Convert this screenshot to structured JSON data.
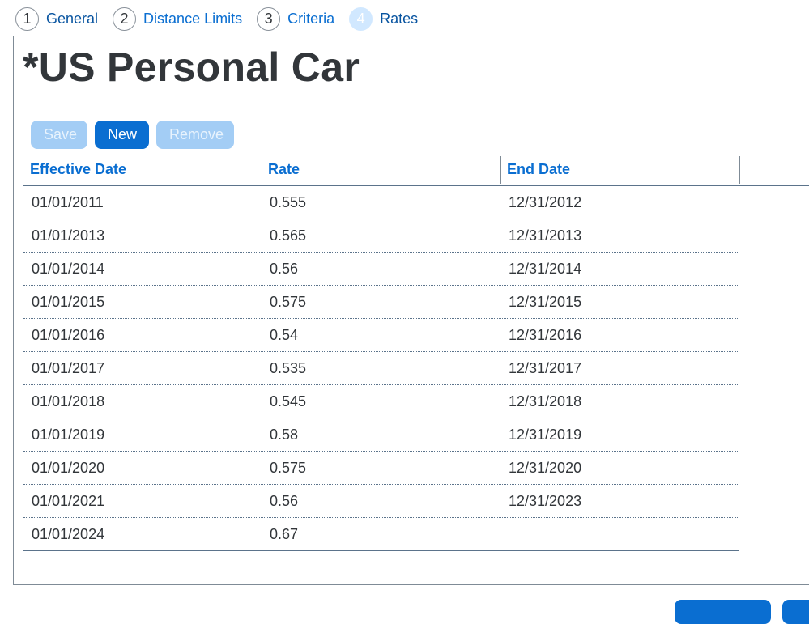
{
  "wizard": {
    "steps": [
      {
        "number": "1",
        "label": "General"
      },
      {
        "number": "2",
        "label": "Distance Limits"
      },
      {
        "number": "3",
        "label": "Criteria"
      },
      {
        "number": "4",
        "label": "Rates"
      }
    ],
    "current_step": 4
  },
  "page": {
    "title": "*US Personal Car"
  },
  "toolbar": {
    "save_label": "Save",
    "new_label": "New",
    "remove_label": "Remove"
  },
  "table": {
    "columns": [
      "Effective Date",
      "Rate",
      "End Date"
    ],
    "rows": [
      [
        "01/01/2011",
        "0.555",
        "12/31/2012"
      ],
      [
        "01/01/2013",
        "0.565",
        "12/31/2013"
      ],
      [
        "01/01/2014",
        "0.56",
        "12/31/2014"
      ],
      [
        "01/01/2015",
        "0.575",
        "12/31/2015"
      ],
      [
        "01/01/2016",
        "0.54",
        "12/31/2016"
      ],
      [
        "01/01/2017",
        "0.535",
        "12/31/2017"
      ],
      [
        "01/01/2018",
        "0.545",
        "12/31/2018"
      ],
      [
        "01/01/2019",
        "0.58",
        "12/31/2019"
      ],
      [
        "01/01/2020",
        "0.575",
        "12/31/2020"
      ],
      [
        "01/01/2021",
        "0.56",
        "12/31/2023"
      ],
      [
        "01/01/2024",
        "0.67",
        ""
      ]
    ]
  },
  "colors": {
    "accent": "#0a6ed1",
    "accent_disabled": "#a3cdf5",
    "text": "#32363a"
  }
}
